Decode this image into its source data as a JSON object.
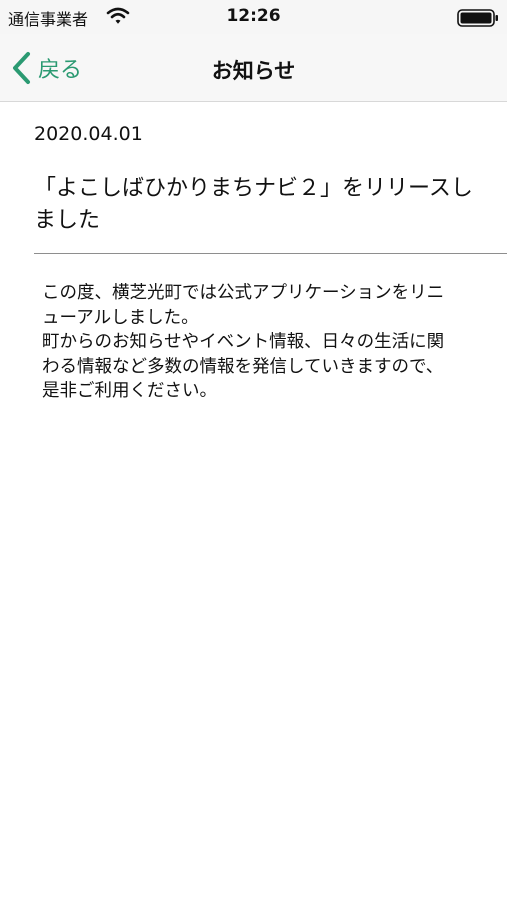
{
  "status_bar": {
    "carrier": "通信事業者",
    "time": "12:26",
    "icons": [
      "wifi-icon",
      "battery-icon"
    ]
  },
  "nav": {
    "back_label": "戻る",
    "title": "お知らせ",
    "accent_color": "#2b9a72"
  },
  "notice": {
    "date": "2020.04.01",
    "headline": "「よこしばひかりまちナビ２」をリリースしました",
    "body": "この度、横芝光町では公式アプリケーションをリニューアルしました。\n町からのお知らせやイベント情報、日々の生活に関わる情報など多数の情報を発信していきますので、是非ご利用ください。"
  }
}
